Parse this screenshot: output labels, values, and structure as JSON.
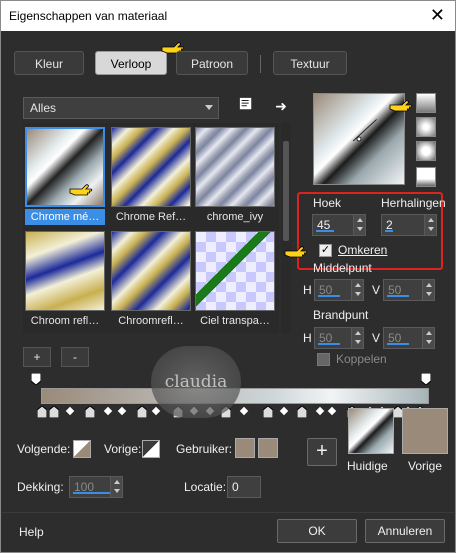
{
  "window": {
    "title": "Eigenschappen van materiaal",
    "close_symbol": "✕"
  },
  "tabs": [
    {
      "label": "Kleur"
    },
    {
      "label": "Verloop",
      "active": true
    },
    {
      "label": "Patroon"
    },
    {
      "label": "Textuur"
    }
  ],
  "library": {
    "dropdown_value": "Alles",
    "items": [
      {
        "label": "Chrome mé…",
        "selected": true
      },
      {
        "label": "Chrome Ref…"
      },
      {
        "label": "chrome_ivy"
      },
      {
        "label": "Chroom refl…"
      },
      {
        "label": "Chroomrefl…"
      },
      {
        "label": "Ciel transpa…"
      }
    ],
    "add_label": "+",
    "remove_label": "-"
  },
  "style_buttons": [
    "linear",
    "rectangular",
    "sunburst",
    "radial"
  ],
  "settings": {
    "angle_label": "Hoek",
    "angle_value": "45",
    "repeats_label": "Herhalingen",
    "repeats_value": "2",
    "invert_label": "Omkeren",
    "invert_checked": true,
    "centerpoint_label": "Middelpunt",
    "center_h_label": "H",
    "center_h_value": "50",
    "center_v_label": "V",
    "center_v_value": "50",
    "focal_label": "Brandpunt",
    "focal_h_label": "H",
    "focal_h_value": "50",
    "focal_v_label": "V",
    "focal_v_value": "50",
    "link_label": "Koppelen"
  },
  "watermark_text": "claudia",
  "bottom": {
    "next_label": "Volgende:",
    "prev_label": "Vorige:",
    "user_label": "Gebruiker:",
    "opacity_label": "Dekking:",
    "opacity_value": "100",
    "location_label": "Locatie:",
    "location_value": "0",
    "current_label": "Huidige",
    "previous_label": "Vorige",
    "add_symbol": "+"
  },
  "footer": {
    "help": "Help",
    "ok": "OK",
    "cancel": "Annuleren"
  },
  "colors": {
    "accent": "#3a8ee6",
    "highlight_box": "#dd2222",
    "user_swatch": "#9a8a7a"
  }
}
